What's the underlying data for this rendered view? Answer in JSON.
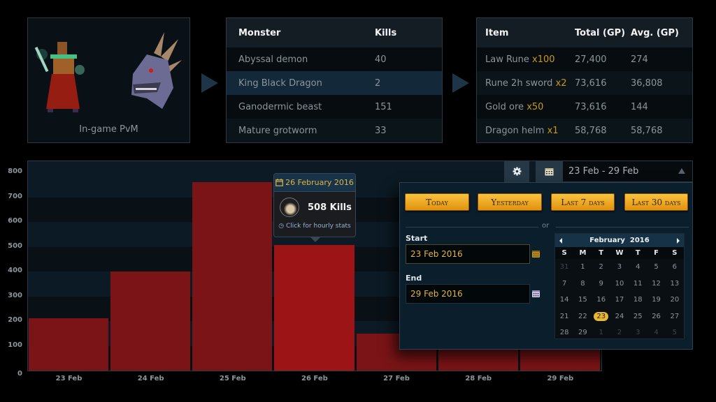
{
  "pvm_card": {
    "caption": "In-game PvM",
    "sprites": [
      "player-character",
      "king-black-dragon-head"
    ]
  },
  "monsters_table": {
    "headers": [
      "Monster",
      "Kills"
    ],
    "rows": [
      {
        "name": "Abyssal demon",
        "kills": "40"
      },
      {
        "name": "King Black Dragon",
        "kills": "2",
        "highlighted": true
      },
      {
        "name": "Ganodermic beast",
        "kills": "151"
      },
      {
        "name": "Mature grotworm",
        "kills": "33"
      }
    ]
  },
  "loot_table": {
    "headers": [
      "Item",
      "Total (GP)",
      "Avg. (GP)"
    ],
    "rows": [
      {
        "item": "Law Rune",
        "qty": "x100",
        "total": "27,400",
        "avg": "274"
      },
      {
        "item": "Rune 2h sword",
        "qty": "x2",
        "total": "73,616",
        "avg": "36,808"
      },
      {
        "item": "Gold ore",
        "qty": "x50",
        "total": "73,616",
        "avg": "144"
      },
      {
        "item": "Dragon helm",
        "qty": "x1",
        "total": "58,768",
        "avg": "58,768"
      }
    ]
  },
  "toolbar": {
    "settings_icon": "gear-icon",
    "calendar_icon": "calendar-icon",
    "date_range": "23 Feb - 29 Feb"
  },
  "tooltip": {
    "date": "26 February 2016",
    "kills": "508 Kills",
    "link": "Click for hourly stats"
  },
  "date_picker": {
    "presets": [
      "Today",
      "Yesterday",
      "Last 7 days",
      "Last 30 days"
    ],
    "separator": "or",
    "start_label": "Start",
    "start_value": "23 Feb 2016",
    "end_label": "End",
    "end_value": "29 Feb 2016",
    "calendar": {
      "month": "February",
      "year": "2016",
      "weekdays": [
        "S",
        "M",
        "T",
        "W",
        "T",
        "F",
        "S"
      ],
      "days": [
        {
          "d": "31",
          "muted": true
        },
        {
          "d": "1"
        },
        {
          "d": "2"
        },
        {
          "d": "3"
        },
        {
          "d": "4"
        },
        {
          "d": "5"
        },
        {
          "d": "6"
        },
        {
          "d": "7"
        },
        {
          "d": "8"
        },
        {
          "d": "9"
        },
        {
          "d": "10"
        },
        {
          "d": "11"
        },
        {
          "d": "12"
        },
        {
          "d": "13"
        },
        {
          "d": "14"
        },
        {
          "d": "15"
        },
        {
          "d": "16"
        },
        {
          "d": "17"
        },
        {
          "d": "18"
        },
        {
          "d": "19"
        },
        {
          "d": "20"
        },
        {
          "d": "21"
        },
        {
          "d": "22"
        },
        {
          "d": "23",
          "selected": true
        },
        {
          "d": "24"
        },
        {
          "d": "25"
        },
        {
          "d": "26"
        },
        {
          "d": "27"
        },
        {
          "d": "28"
        },
        {
          "d": "29"
        },
        {
          "d": "1",
          "muted": true
        },
        {
          "d": "2",
          "muted": true
        },
        {
          "d": "3",
          "muted": true
        },
        {
          "d": "4",
          "muted": true
        },
        {
          "d": "5",
          "muted": true
        }
      ]
    }
  },
  "colors": {
    "bar": "#7a1416",
    "bar_active": "#9c1416",
    "accent_gold": "#e4b43c",
    "qty_gold": "#c79a1d"
  },
  "chart_data": {
    "type": "bar",
    "title": "",
    "xlabel": "",
    "ylabel": "",
    "categories": [
      "23 Feb",
      "24 Feb",
      "25 Feb",
      "26 Feb",
      "27 Feb",
      "28 Feb",
      "29 Feb"
    ],
    "values": [
      210,
      400,
      760,
      508,
      150,
      150,
      150
    ],
    "active_index": 3,
    "ylim": [
      0,
      800
    ],
    "yticks": [
      0,
      100,
      200,
      300,
      400,
      500,
      600,
      700,
      800
    ],
    "grid": "alternating-bands"
  }
}
